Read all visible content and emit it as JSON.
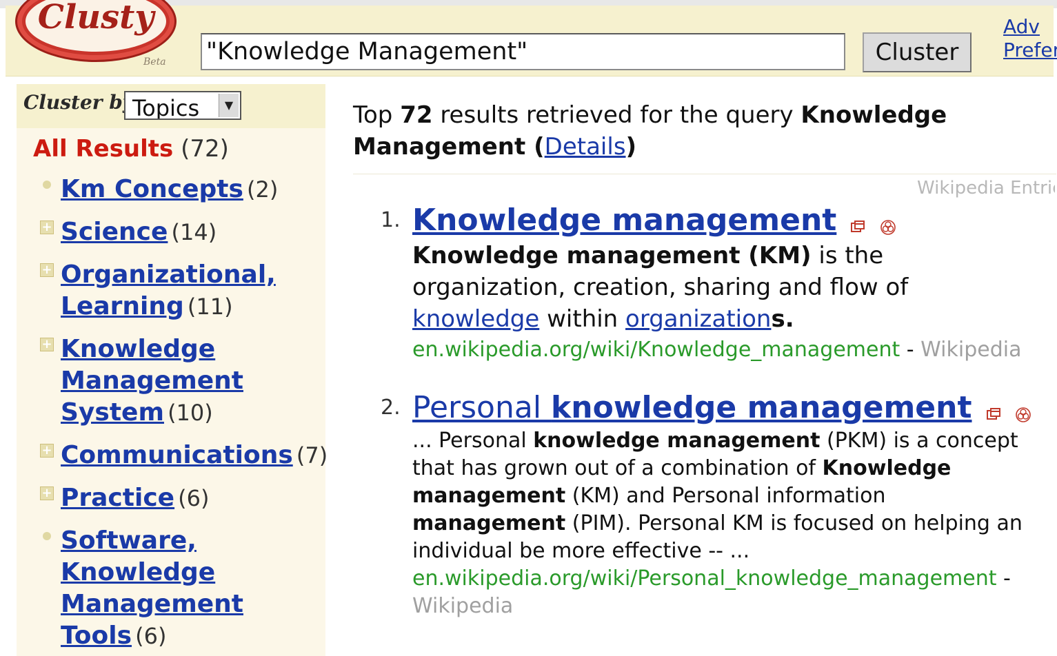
{
  "logo": {
    "text": "Clusty",
    "beta": "Beta"
  },
  "search": {
    "value": "\"Knowledge Management\"",
    "button": "Cluster"
  },
  "top_links": [
    "Adv",
    "Prefer"
  ],
  "sidebar": {
    "cluster_by_label": "Cluster by:",
    "select_value": "Topics",
    "all_results": {
      "label": "All Results",
      "count": "(72)"
    },
    "items": [
      {
        "label": "Km Concepts",
        "count": "(2)",
        "marker": "bullet"
      },
      {
        "label": "Science",
        "count": "(14)",
        "marker": "plus"
      },
      {
        "label": "Organizational, Learning",
        "count": "(11)",
        "marker": "plus"
      },
      {
        "label": "Knowledge Management System",
        "count": "(10)",
        "marker": "plus"
      },
      {
        "label": "Communications",
        "count": "(7)",
        "marker": "plus"
      },
      {
        "label": "Practice",
        "count": "(6)",
        "marker": "plus"
      },
      {
        "label": "Software, Knowledge Management Tools",
        "count": "(6)",
        "marker": "bullet"
      }
    ]
  },
  "main": {
    "header": {
      "prefix": "Top ",
      "count": "72",
      "middle": " results retrieved for the query ",
      "query": "Knowledge Management",
      "paren_open": " (",
      "details_link": "Details",
      "paren_close": ")"
    },
    "source_label": "Wikipedia Entries",
    "results": [
      {
        "number": "1.",
        "title": "Knowledge management",
        "snippet_bold": "Knowledge management (KM)",
        "snippet_1": " is the organization, creation, sharing and flow of ",
        "snippet_link1": "knowledge",
        "snippet_2": " within ",
        "snippet_link2": "organization",
        "snippet_3": "s.",
        "url": "en.wikipedia.org/wiki/Knowledge_management",
        "separator": " - ",
        "source": "Wikipedia"
      },
      {
        "number": "2.",
        "title_plain": "Personal ",
        "title_bold": "knowledge management",
        "snippet_a": "... Personal ",
        "snippet_b_bold": "knowledge management",
        "snippet_c": " (PKM) is a concept that has grown out of a combination of ",
        "snippet_d_bold": "Knowledge management",
        "snippet_e": " (KM) and Personal information ",
        "snippet_f_bold": "management",
        "snippet_g": " (PIM). Personal KM is focused on helping an individual be more effective -- ...",
        "url": "en.wikipedia.org/wiki/Personal_knowledge_management",
        "separator": " - ",
        "source": "Wikipedia"
      }
    ]
  },
  "colors": {
    "header_bg": "#f6f1cf",
    "sidebar_bg": "#fcf7e8",
    "link": "#1a3aa8",
    "all_results": "#cc1b10",
    "url": "#2a9a2a"
  }
}
